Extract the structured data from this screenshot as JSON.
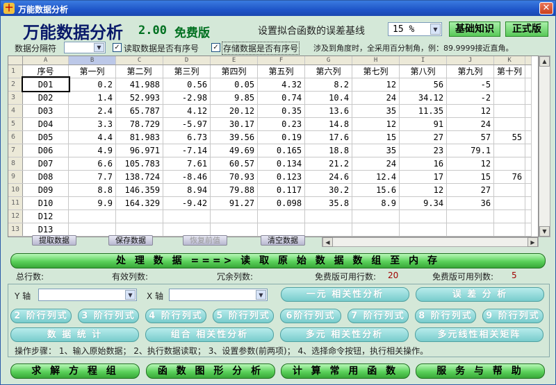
{
  "window": {
    "title": "万能数据分析",
    "app_icon": "十",
    "close": "✕"
  },
  "header": {
    "app_name": "万能数据分析",
    "version": "2.00",
    "edition": "免费版",
    "error_label": "设置拟合函数的误差基线",
    "error_value": "15 %",
    "basics_button": "基础知识",
    "pro_button": "正式版"
  },
  "options": {
    "separator_label": "数据分隔符",
    "separator_value": "",
    "read_has_index": "读取数据是否有序号",
    "read_has_index_checked": "✓",
    "store_has_index": "存储数据是否有序号",
    "store_has_index_checked": "✓",
    "angle_note": "涉及到角度时，全采用百分制角，例：89.9999接近直角。"
  },
  "grid": {
    "col_letters": [
      "A",
      "B",
      "C",
      "D",
      "E",
      "F",
      "G",
      "H",
      "I",
      "J",
      "K"
    ],
    "row_numbers": [
      "1",
      "2",
      "3",
      "4",
      "5",
      "6",
      "7",
      "8",
      "9",
      "10",
      "11",
      "12",
      "13"
    ],
    "headers": [
      "序号",
      "第一列",
      "第二列",
      "第三列",
      "第四列",
      "第五列",
      "第六列",
      "第七列",
      "第八列",
      "第九列",
      "第十列"
    ],
    "rows": [
      [
        "D01",
        "0.2",
        "41.988",
        "0.56",
        "0.05",
        "4.32",
        "8.2",
        "12",
        "56",
        "-5",
        ""
      ],
      [
        "D02",
        "1.4",
        "52.993",
        "-2.98",
        "9.85",
        "0.74",
        "10.4",
        "24",
        "34.12",
        "-2",
        ""
      ],
      [
        "D03",
        "2.4",
        "65.787",
        "4.12",
        "20.12",
        "0.35",
        "13.6",
        "35",
        "11.35",
        "12",
        ""
      ],
      [
        "D04",
        "3.3",
        "78.729",
        "-5.97",
        "30.17",
        "0.23",
        "14.8",
        "12",
        "91",
        "24",
        ""
      ],
      [
        "D05",
        "4.4",
        "81.983",
        "6.73",
        "39.56",
        "0.19",
        "17.6",
        "15",
        "27",
        "57",
        "55"
      ],
      [
        "D06",
        "4.9",
        "96.971",
        "-7.14",
        "49.69",
        "0.165",
        "18.8",
        "35",
        "23",
        "79.1",
        ""
      ],
      [
        "D07",
        "6.6",
        "105.783",
        "7.61",
        "60.57",
        "0.134",
        "21.2",
        "24",
        "16",
        "12",
        ""
      ],
      [
        "D08",
        "7.7",
        "138.724",
        "-8.46",
        "70.93",
        "0.123",
        "24.6",
        "12.4",
        "17",
        "15",
        "76"
      ],
      [
        "D09",
        "8.8",
        "146.359",
        "8.94",
        "79.88",
        "0.117",
        "30.2",
        "15.6",
        "12",
        "27",
        ""
      ],
      [
        "D10",
        "9.9",
        "164.329",
        "-9.42",
        "91.27",
        "0.098",
        "35.8",
        "8.9",
        "9.34",
        "36",
        ""
      ],
      [
        "D12",
        "",
        "",
        "",
        "",
        "",
        "",
        "",
        "",
        "",
        ""
      ],
      [
        "D13",
        "",
        "",
        "",
        "",
        "",
        "",
        "",
        "",
        "",
        ""
      ]
    ]
  },
  "tabs": {
    "extract": "提取数据",
    "save": "保存数据",
    "restore": "恢复前值",
    "clear": "清空数据"
  },
  "process": {
    "label": "处 理 数 据 ===> 读 取 原 始 数 据 数 组 至 内 存"
  },
  "stats": {
    "total_rows": "总行数:",
    "valid_cols": "有效列数:",
    "redundant_cols": "冗余列数:",
    "free_rows_label": "免费版可用行数:",
    "free_rows_value": "20",
    "free_cols_label": "免费版可用列数:",
    "free_cols_value": "5"
  },
  "axes": {
    "y_label": "Y 轴",
    "x_label": "X 轴"
  },
  "analysis": {
    "unary_corr": "一元 相关性分析",
    "error_analysis": "误 差 分 析",
    "order2": "2 阶行列式",
    "order3": "3 阶行列式",
    "order4": "4 阶行列式",
    "order5": "5 阶行列式",
    "order6": "6阶行列式",
    "order7": "7 阶行列式",
    "order8": "8 阶行列式",
    "order9": "9 阶行列式",
    "data_stats": "数 据 统 计",
    "combo_corr": "组合 相关性分析",
    "multi_corr": "多元 相关性分析",
    "multi_linear": "多元线性相关矩阵"
  },
  "steps": "操作步骤： 1、输入原始数据； 2、执行数据读取； 3、设置参数(前两项)； 4、选择命令按钮，执行相关操作。",
  "bottom": {
    "solve": "求 解 方 程 组",
    "graph": "函 数 图 形 分 析",
    "calc": "计 算 常 用 函 数",
    "service": "服 务 与 帮 助"
  },
  "scroll": {
    "up": "▲",
    "down": "▼",
    "left": "◀",
    "right": "▶",
    "dropdown": "▼"
  }
}
